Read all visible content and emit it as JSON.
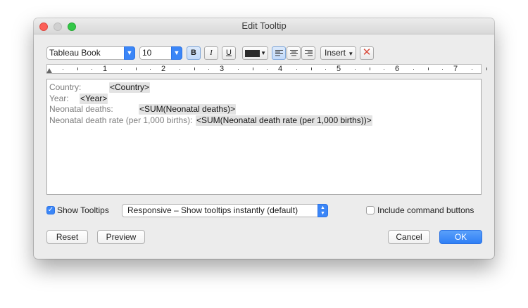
{
  "window": {
    "title": "Edit Tooltip"
  },
  "toolbar": {
    "font_family": "Tableau Book",
    "font_size": "10",
    "bold_label": "B",
    "italic_label": "I",
    "underline_label": "U",
    "text_color": "#2b2b2b",
    "insert_label": "Insert",
    "clear_glyph": "✕"
  },
  "ruler": {
    "marks": [
      "1",
      "2",
      "3",
      "4",
      "5",
      "6",
      "7"
    ]
  },
  "editor": {
    "lines": [
      {
        "label": "Country:",
        "field": "<Country>"
      },
      {
        "label": "Year:",
        "field": "<Year>"
      },
      {
        "label": "Neonatal deaths:",
        "field": "<SUM(Neonatal deaths)>"
      },
      {
        "label": "Neonatal death rate (per 1,000 births):",
        "field": "<SUM(Neonatal death rate (per 1,000 births))>"
      }
    ]
  },
  "options": {
    "show_tooltips_label": "Show Tooltips",
    "show_tooltips_checked": true,
    "mode_selected": "Responsive – Show tooltips instantly (default)",
    "include_buttons_label": "Include command buttons",
    "include_buttons_checked": false
  },
  "buttons": {
    "reset": "Reset",
    "preview": "Preview",
    "cancel": "Cancel",
    "ok": "OK"
  },
  "colors": {
    "accent": "#3b86f7",
    "close": "#fc5f57",
    "maximize": "#33c748",
    "field_bg": "#e3e3e3"
  }
}
